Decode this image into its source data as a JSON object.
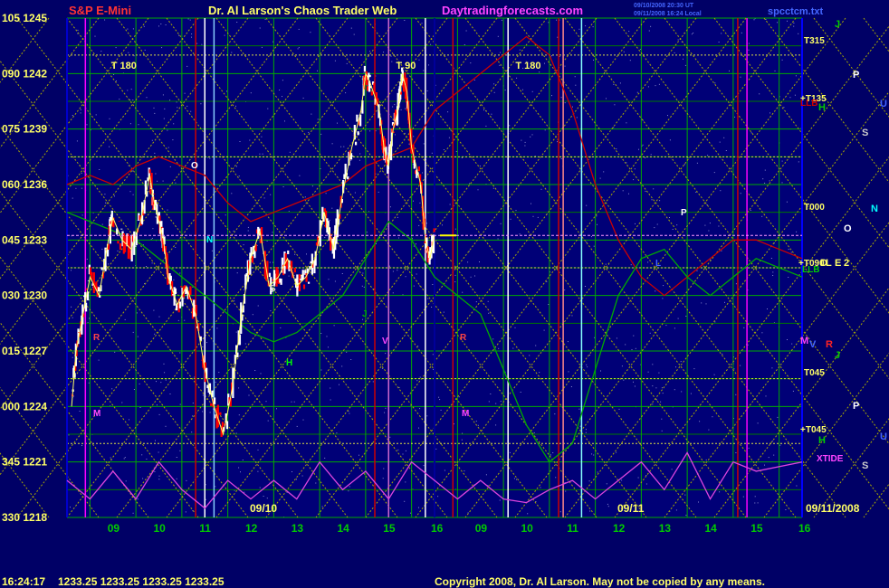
{
  "header": {
    "instrument": "S&P E-Mini",
    "title": "Dr. Al Larson's Chaos Trader Web",
    "site": "Daytradingforecasts.com",
    "timestamp_line1": "09/10/2008 20:30 UT",
    "timestamp_line2": "09/11/2008 16:24 Local",
    "filename": "spcctcm.txt"
  },
  "footer": {
    "clock": "16:24:17",
    "quote": "1233.25 1233.25 1233.25 1233.25",
    "copyright": "Copyright 2008, Dr. Al Larson. May not be copied by any means."
  },
  "colors": {
    "background": "#000066",
    "price": "#ffffff",
    "down_bar": "#ff0000",
    "grid_green": "#00aa00",
    "grid_yellow": "#aaaa00",
    "flux_red": "#cc0000",
    "flux_green": "#00aa00",
    "xtide": "#dd44dd",
    "time_white": "#ffffff",
    "blue_axis": "#0000ff"
  },
  "chart_data": {
    "type": "line",
    "y_labels": [
      {
        "angle": "105",
        "price": "1245"
      },
      {
        "angle": "090",
        "price": "1242"
      },
      {
        "angle": "075",
        "price": "1239"
      },
      {
        "angle": "060",
        "price": "1236"
      },
      {
        "angle": "045",
        "price": "1233"
      },
      {
        "angle": "030",
        "price": "1230"
      },
      {
        "angle": "015",
        "price": "1227"
      },
      {
        "angle": "000",
        "price": "1224"
      },
      {
        "angle": "345",
        "price": "1221"
      },
      {
        "angle": "330",
        "price": "1218"
      }
    ],
    "ylim": [
      1218,
      1245
    ],
    "x_hours": [
      "09",
      "10",
      "11",
      "12",
      "13",
      "14",
      "15",
      "16"
    ],
    "dates": [
      "09/10",
      "09/11"
    ],
    "date_label": "09/11/2008",
    "last_price": 1233.25,
    "price_series": [
      [
        8.1,
        1224
      ],
      [
        8.2,
        1227
      ],
      [
        8.35,
        1229
      ],
      [
        8.5,
        1231
      ],
      [
        8.7,
        1230
      ],
      [
        8.9,
        1233
      ],
      [
        9.0,
        1234.2
      ],
      [
        9.2,
        1233
      ],
      [
        9.4,
        1232.5
      ],
      [
        9.6,
        1234
      ],
      [
        9.8,
        1236.5
      ],
      [
        9.9,
        1235
      ],
      [
        10.0,
        1234
      ],
      [
        10.1,
        1233
      ],
      [
        10.2,
        1231
      ],
      [
        10.4,
        1229.5
      ],
      [
        10.6,
        1230.5
      ],
      [
        10.8,
        1229
      ],
      [
        11.0,
        1226
      ],
      [
        11.2,
        1224
      ],
      [
        11.4,
        1222.5
      ],
      [
        11.6,
        1225
      ],
      [
        11.8,
        1229
      ],
      [
        12.0,
        1232
      ],
      [
        12.2,
        1233.5
      ],
      [
        12.4,
        1230.5
      ],
      [
        12.6,
        1231
      ],
      [
        12.8,
        1232
      ],
      [
        13.0,
        1230.5
      ],
      [
        13.2,
        1231
      ],
      [
        13.4,
        1232
      ],
      [
        13.6,
        1234.5
      ],
      [
        13.8,
        1232.5
      ],
      [
        14.0,
        1235.5
      ],
      [
        14.2,
        1238
      ],
      [
        14.4,
        1240
      ],
      [
        14.5,
        1242
      ],
      [
        14.6,
        1241.5
      ],
      [
        14.8,
        1240
      ],
      [
        14.9,
        1238
      ],
      [
        15.0,
        1237
      ],
      [
        15.1,
        1239
      ],
      [
        15.2,
        1240
      ],
      [
        15.3,
        1242
      ],
      [
        15.4,
        1241
      ],
      [
        15.5,
        1238
      ],
      [
        15.7,
        1236
      ],
      [
        15.8,
        1233
      ],
      [
        15.9,
        1232
      ],
      [
        16.0,
        1233.25
      ]
    ],
    "x_range": [
      8.0,
      16.0
    ],
    "series": [
      {
        "values_note_hidden": "",
        "points": [
          [
            8.0,
            1236
          ],
          [
            8.5,
            1236.5
          ],
          [
            9.0,
            1236
          ],
          [
            9.5,
            1237
          ],
          [
            10.0,
            1237.5
          ],
          [
            10.5,
            1237
          ],
          [
            11.0,
            1236.5
          ],
          [
            11.5,
            1235
          ],
          [
            12.0,
            1234
          ],
          [
            12.5,
            1234.5
          ],
          [
            13.0,
            1235
          ],
          [
            13.5,
            1235.5
          ],
          [
            14.0,
            1236
          ],
          [
            14.5,
            1237
          ],
          [
            15.0,
            1237.5
          ],
          [
            15.5,
            1238
          ],
          [
            16.0,
            1240
          ],
          [
            16.5,
            1241
          ],
          [
            17.0,
            1242
          ],
          [
            17.5,
            1243
          ],
          [
            18.0,
            1244
          ],
          [
            18.5,
            1243
          ],
          [
            19.0,
            1240
          ],
          [
            19.5,
            1236
          ],
          [
            20.0,
            1233
          ],
          [
            20.5,
            1231
          ],
          [
            21.0,
            1230
          ],
          [
            21.5,
            1231
          ],
          [
            22.0,
            1232
          ],
          [
            22.5,
            1233
          ],
          [
            23.0,
            1233
          ],
          [
            24.0,
            1232
          ]
        ]
      },
      {
        "points": [
          [
            8.0,
            1234.5
          ],
          [
            8.5,
            1234
          ],
          [
            9.0,
            1233.5
          ],
          [
            9.5,
            1233
          ],
          [
            10.0,
            1232
          ],
          [
            10.5,
            1231
          ],
          [
            11.0,
            1230
          ],
          [
            11.5,
            1229
          ],
          [
            12.0,
            1228
          ],
          [
            12.5,
            1227.5
          ],
          [
            13.0,
            1228
          ],
          [
            13.5,
            1229
          ],
          [
            14.0,
            1230
          ],
          [
            14.5,
            1232
          ],
          [
            15.0,
            1234
          ],
          [
            15.5,
            1233
          ],
          [
            16.0,
            1231
          ],
          [
            16.5,
            1230
          ],
          [
            17.0,
            1229
          ],
          [
            17.5,
            1226
          ],
          [
            18.0,
            1223
          ],
          [
            18.5,
            1221
          ],
          [
            19.0,
            1222
          ],
          [
            19.5,
            1226
          ],
          [
            20.0,
            1230
          ],
          [
            20.5,
            1232
          ],
          [
            21.0,
            1232.5
          ],
          [
            21.5,
            1231
          ],
          [
            22.0,
            1230
          ],
          [
            22.5,
            1231
          ],
          [
            23.0,
            1232
          ],
          [
            24.0,
            1231
          ]
        ]
      },
      {
        "points": [
          [
            8.0,
            1220
          ],
          [
            8.5,
            1219
          ],
          [
            9.0,
            1220.5
          ],
          [
            9.5,
            1219
          ],
          [
            10.0,
            1221
          ],
          [
            10.5,
            1219.5
          ],
          [
            11.0,
            1218.5
          ],
          [
            11.5,
            1220
          ],
          [
            12.0,
            1219
          ],
          [
            12.5,
            1220
          ],
          [
            13.0,
            1219
          ],
          [
            13.5,
            1221
          ],
          [
            14.0,
            1219.5
          ],
          [
            14.5,
            1220.5
          ],
          [
            15.0,
            1219
          ],
          [
            15.5,
            1221
          ],
          [
            16.0,
            1220
          ],
          [
            16.5,
            1219
          ],
          [
            17.0,
            1220
          ],
          [
            17.5,
            1219
          ],
          [
            18.0,
            1218.8
          ],
          [
            18.5,
            1219.5
          ],
          [
            19.0,
            1220
          ],
          [
            19.5,
            1219
          ],
          [
            20.0,
            1220
          ],
          [
            20.5,
            1221
          ],
          [
            21.0,
            1219.5
          ],
          [
            21.5,
            1221.5
          ],
          [
            22.0,
            1219
          ],
          [
            22.5,
            1221
          ],
          [
            23.0,
            1220.5
          ],
          [
            24.0,
            1221
          ]
        ]
      }
    ],
    "time_lines": [
      {
        "label": "T 180",
        "x": 9.0
      },
      {
        "label": "T 90",
        "x": 15.2
      },
      {
        "label": "T 180",
        "x": 17.8
      }
    ],
    "right_labels": [
      "T315",
      "+T135",
      "T000",
      "+T090",
      "T045",
      "+T045",
      "XTIDE",
      "LLB",
      "LLB"
    ],
    "planet_labels": [
      "P",
      "U",
      "S",
      "N",
      "O",
      "P",
      "U",
      "S",
      "J",
      "H",
      "M",
      "V",
      "R",
      "J",
      "H",
      "D",
      "L",
      "E",
      "2"
    ],
    "marker_labels": [
      "O",
      "R",
      "M",
      "N",
      "S",
      "H",
      "J",
      "V",
      "P",
      "L",
      "R",
      "M"
    ]
  }
}
